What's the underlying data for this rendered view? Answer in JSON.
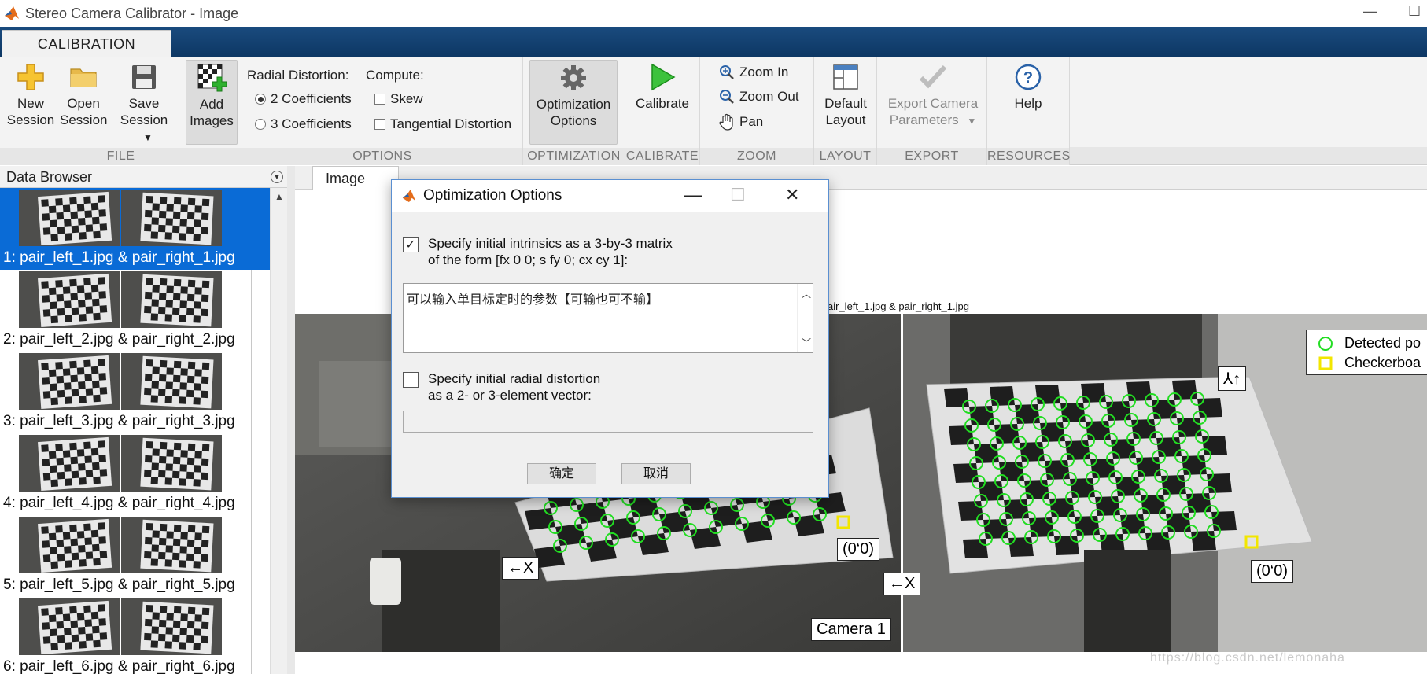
{
  "window": {
    "title": "Stereo Camera Calibrator - Image",
    "controls": [
      "—",
      "☐"
    ]
  },
  "ribbon": {
    "tab": "CALIBRATION",
    "file": {
      "label": "FILE",
      "new_session": [
        "New",
        "Session"
      ],
      "open_session": [
        "Open",
        "Session"
      ],
      "save_session": [
        "Save",
        "Session"
      ],
      "add_images": [
        "Add",
        "Images"
      ]
    },
    "options": {
      "label": "OPTIONS",
      "radial_label": "Radial Distortion:",
      "coef2": "2 Coefficients",
      "coef3": "3 Coefficients",
      "compute_label": "Compute:",
      "skew": "Skew",
      "tangential": "Tangential Distortion",
      "selected_coefficients": "2 Coefficients"
    },
    "optimization": {
      "label": "OPTIMIZATION",
      "button": [
        "Optimization",
        "Options"
      ]
    },
    "calibrate": {
      "label": "CALIBRATE",
      "button": "Calibrate"
    },
    "zoom": {
      "label": "ZOOM",
      "zoom_in": "Zoom In",
      "zoom_out": "Zoom Out",
      "pan": "Pan"
    },
    "layout": {
      "label": "LAYOUT",
      "button": [
        "Default",
        "Layout"
      ]
    },
    "export": {
      "label": "EXPORT",
      "button": [
        "Export Camera",
        "Parameters"
      ]
    },
    "resources": {
      "label": "RESOURCES",
      "button": "Help"
    }
  },
  "browser": {
    "title": "Data Browser",
    "items": [
      {
        "label": "1: pair_left_1.jpg & pair_right_1.jpg",
        "selected": true
      },
      {
        "label": "2: pair_left_2.jpg & pair_right_2.jpg",
        "selected": false
      },
      {
        "label": "3: pair_left_3.jpg & pair_right_3.jpg",
        "selected": false
      },
      {
        "label": "4: pair_left_4.jpg & pair_right_4.jpg",
        "selected": false
      },
      {
        "label": "5: pair_left_5.jpg & pair_right_5.jpg",
        "selected": false
      },
      {
        "label": "6: pair_left_6.jpg & pair_right_6.jpg",
        "selected": false
      }
    ]
  },
  "document": {
    "tab": "Image",
    "figure_title_fragment": "air_left_1.jpg & pair_right_1.jpg",
    "legend": {
      "detected": "Detected po",
      "origin": "Checkerboa"
    },
    "labels": {
      "left_x": "←X",
      "left_origin": "(0‘0)",
      "camera": "Camera 1",
      "right_x": "←X",
      "right_origin": "(0‘0)",
      "right_y": "⅄↑"
    },
    "watermark": "https://blog.csdn.net/lemonaha"
  },
  "dialog": {
    "title": "Optimization Options",
    "intrinsics_checked": true,
    "intrinsics_line1": "Specify initial intrinsics as a 3-by-3 matrix",
    "intrinsics_line2": "of the form [fx 0 0; s fy 0; cx cy 1]:",
    "intrinsics_value": "可以输入单目标定时的参数【可输也可不输】",
    "radial_checked": false,
    "radial_line1": "Specify initial radial distortion",
    "radial_line2": "as a 2- or 3-element vector:",
    "radial_value": "",
    "ok": "确定",
    "cancel": "取消"
  },
  "colors": {
    "ribbon_tab_bar": "#0d3764",
    "selection": "#0a6bd6",
    "detected_points": "#22dd22",
    "origin_marker": "#f2e600"
  }
}
